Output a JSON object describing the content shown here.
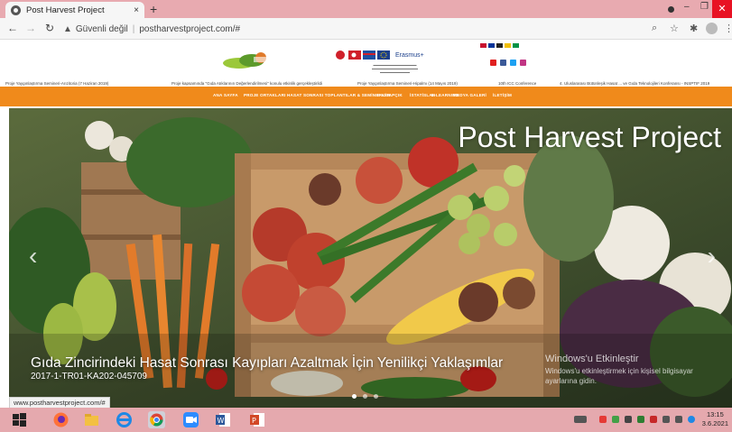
{
  "browser": {
    "tab_title": "Post Harvest Project",
    "tab_close": "×",
    "new_tab": "+",
    "security_label": "Güvenli değil",
    "url": "postharvestproject.com/#",
    "status_url": "www.postharvestproject.com/#"
  },
  "header": {
    "erasmus_label": "Erasmus+",
    "news_items": [
      "Proje Yaygınlaştırma Semineri-Arızitoria (7 Haziran 2019)",
      "Proje kapsamında \"Gıda Atıklarının Değerlendirilmesi\" konulu etkinlik gerçekleştirildi",
      "Proje Yaygınlaştırma Semineri-Hipalmı (14 Mayıs 2019)",
      "10th ICC Conference",
      "4. Uluslararası Bütünleşik Hasat ... ve Gıda Teknolojileri Konferansı - INSPTIF 2019"
    ]
  },
  "nav": {
    "items": [
      "ANA SAYFA",
      "PROJE ORTAKLARI",
      "HASAT SONRASI TOPLANTILAR & SEMİNERLER",
      "E-KİTAPÇIK",
      "İSTATİSLAR",
      "E-LEARNING",
      "MEDYA GALERİ",
      "İLETİŞİM"
    ]
  },
  "hero": {
    "title": "Post Harvest Project",
    "headline": "Gıda Zincirindeki Hasat Sonrası Kayıpları Azaltmak İçin Yenilikçi Yaklaşımlar",
    "project_code": "2017-1-TR01-KA202-045709",
    "prev": "‹",
    "next": "›"
  },
  "watermark": {
    "title": "Windows'u Etkinleştir",
    "text": "Windows'u etkinleştirmek için kişisel bilgisayar ayarlarına gidin."
  },
  "taskbar": {
    "time": "13:15",
    "date": "3.6.2021"
  },
  "colors": {
    "accent_orange": "#f08a1b",
    "tab_strip": "#e8aab0",
    "taskbar": "#e5a9ae"
  }
}
